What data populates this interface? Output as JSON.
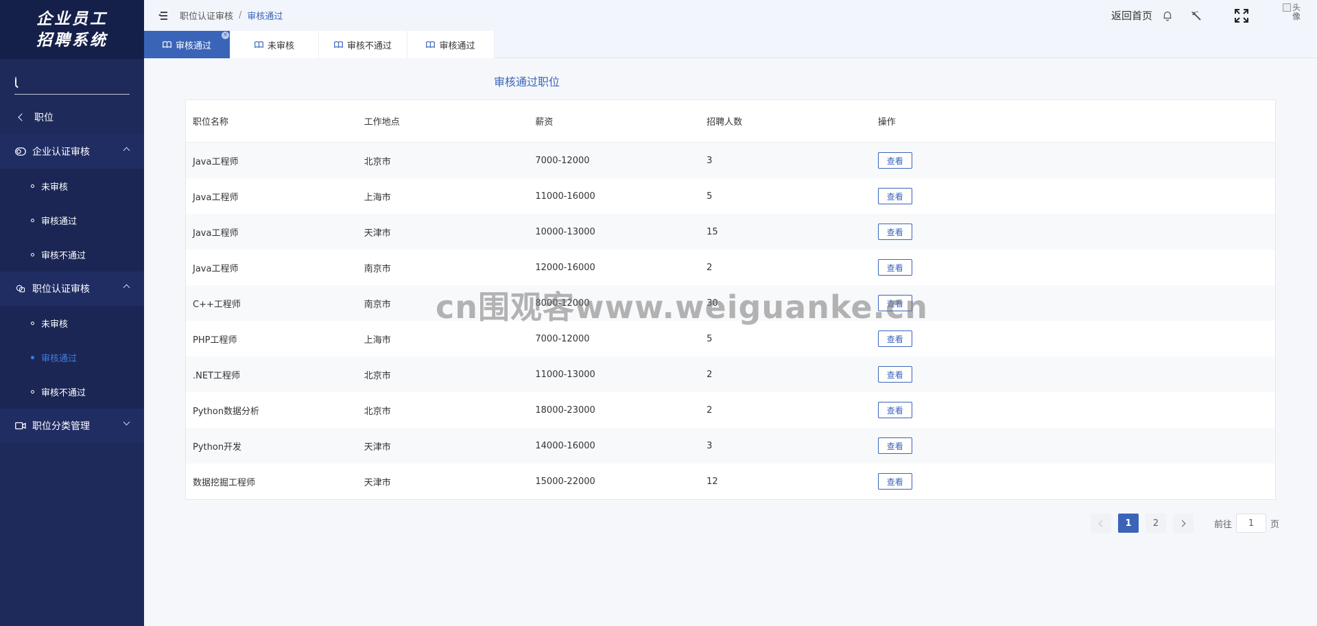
{
  "sidebar": {
    "logo_line1": "企业员工",
    "logo_line2": "招聘系统",
    "search_placeholder": "",
    "back_label": "职位",
    "groups": [
      {
        "title": "企业认证审核",
        "expanded": true,
        "items": [
          "未审核",
          "审核通过",
          "审核不通过"
        ]
      },
      {
        "title": "职位认证审核",
        "expanded": true,
        "items": [
          "未审核",
          "审核通过",
          "审核不通过"
        ],
        "active_item": "审核通过"
      },
      {
        "title": "职位分类管理",
        "expanded": false,
        "items": []
      }
    ]
  },
  "header": {
    "breadcrumb_parent": "职位认证审核",
    "breadcrumb_sep": "/",
    "breadcrumb_current": "审核通过",
    "home_link": "返回首页",
    "avatar_alt": "头像"
  },
  "tabs": [
    {
      "label": "审核通过",
      "active": true
    },
    {
      "label": "未审核",
      "active": false
    },
    {
      "label": "审核不通过",
      "active": false
    },
    {
      "label": "审核通过",
      "active": false
    }
  ],
  "tab_close": "×",
  "main": {
    "title": "审核通过职位",
    "columns": [
      "职位名称",
      "工作地点",
      "薪资",
      "招聘人数",
      "操作"
    ],
    "view_label": "查看",
    "rows": [
      {
        "name": "Java工程师",
        "location": "北京市",
        "salary": "7000-12000",
        "count": "3"
      },
      {
        "name": "Java工程师",
        "location": "上海市",
        "salary": "11000-16000",
        "count": "5"
      },
      {
        "name": "Java工程师",
        "location": "天津市",
        "salary": "10000-13000",
        "count": "15"
      },
      {
        "name": "Java工程师",
        "location": "南京市",
        "salary": "12000-16000",
        "count": "2"
      },
      {
        "name": "C++工程师",
        "location": "南京市",
        "salary": "8000-12000",
        "count": "30"
      },
      {
        "name": "PHP工程师",
        "location": "上海市",
        "salary": "7000-12000",
        "count": "5"
      },
      {
        "name": ".NET工程师",
        "location": "北京市",
        "salary": "11000-13000",
        "count": "2"
      },
      {
        "name": "Python数据分析",
        "location": "北京市",
        "salary": "18000-23000",
        "count": "2"
      },
      {
        "name": "Python开发",
        "location": "天津市",
        "salary": "14000-16000",
        "count": "3"
      },
      {
        "name": "数据挖掘工程师",
        "location": "天津市",
        "salary": "15000-22000",
        "count": "12"
      }
    ]
  },
  "pagination": {
    "pages": [
      "1",
      "2"
    ],
    "current": "1",
    "goto_prefix": "前往",
    "goto_value": "1",
    "goto_suffix": "页"
  },
  "watermark": "cn围观客www.weiguanke.cn",
  "colors": {
    "sidebar_bg": "#1e2a5a",
    "accent": "#3a64b8",
    "active_item": "#3f7dde"
  }
}
